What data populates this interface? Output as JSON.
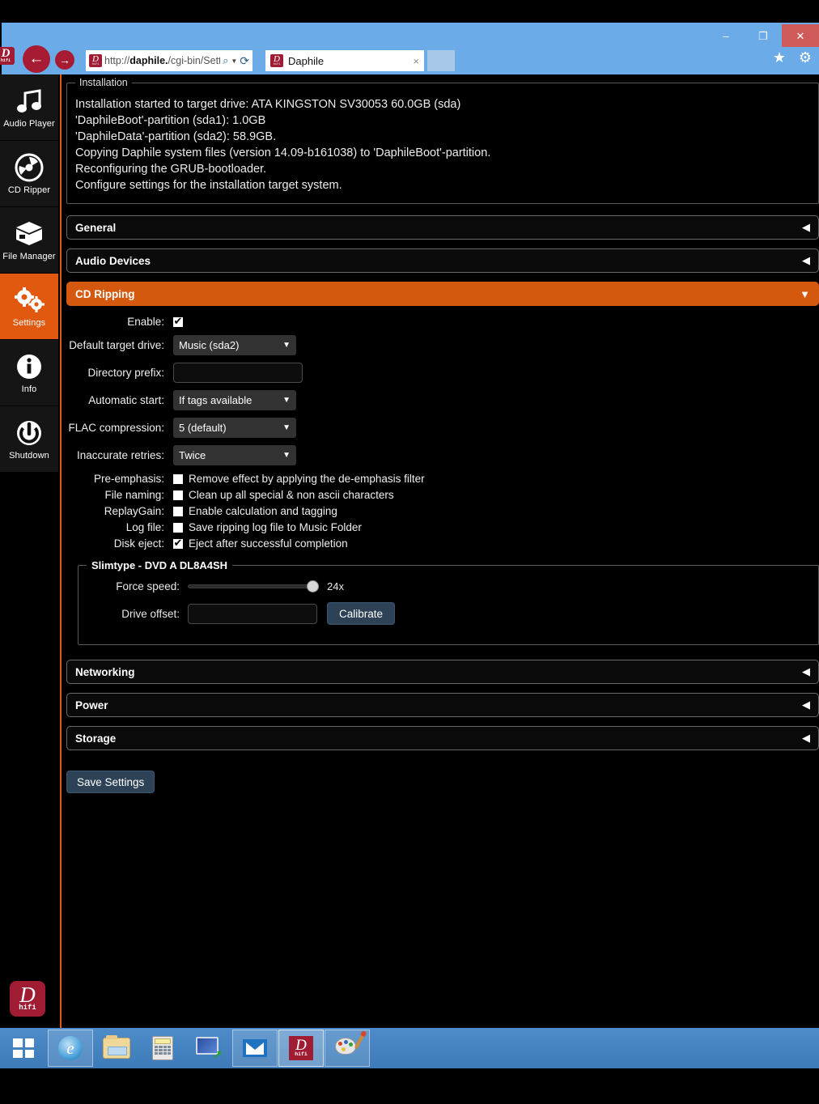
{
  "browser": {
    "url_prefix": "http://",
    "url_domain": "daphile.",
    "url_path": "/cgi-bin/Sett",
    "tab_title": "Daphile",
    "tab_close": "×",
    "back_icon": "←",
    "forward_icon": "→",
    "search_icon": "⌕",
    "caret_icon": "▼",
    "refresh_icon": "⟳",
    "favorites_icon": "★",
    "tools_icon": "⚙",
    "minimize_label": "–",
    "restore_label": "❐",
    "close_label": "✕",
    "logo_letter": "D",
    "logo_sub": "hifi"
  },
  "sidebar": {
    "items": [
      {
        "label": "Audio Player",
        "icon": "music-note-icon",
        "glyph": "♫",
        "active": false
      },
      {
        "label": "CD Ripper",
        "icon": "compact-disc-icon",
        "glyph": "◎",
        "active": false
      },
      {
        "label": "File Manager",
        "icon": "box-icon",
        "glyph": "⬛",
        "active": false
      },
      {
        "label": "Settings",
        "icon": "gears-icon",
        "glyph": "⚙",
        "active": true
      },
      {
        "label": "Info",
        "icon": "info-circle-icon",
        "glyph": "ℹ",
        "active": false
      },
      {
        "label": "Shutdown",
        "icon": "power-icon",
        "glyph": "⏻",
        "active": false
      }
    ],
    "logo_letter": "D",
    "logo_sub": "hifi"
  },
  "installation": {
    "legend": "Installation",
    "lines": [
      "Installation started to target drive: ATA KINGSTON SV30053 60.0GB (sda)",
      "'DaphileBoot'-partition (sda1): 1.0GB",
      "'DaphileData'-partition (sda2): 58.9GB.",
      "Copying Daphile system files (version 14.09-b161038) to 'DaphileBoot'-partition.",
      "Reconfiguring the GRUB-bootloader.",
      "Configure settings for the installation target system."
    ]
  },
  "sections": {
    "general": {
      "title": "General",
      "arrow": "◀"
    },
    "audio_devices": {
      "title": "Audio Devices",
      "arrow": "◀"
    },
    "cd_ripping": {
      "title": "CD Ripping",
      "arrow": "▼"
    },
    "networking": {
      "title": "Networking",
      "arrow": "◀"
    },
    "power": {
      "title": "Power",
      "arrow": "◀"
    },
    "storage": {
      "title": "Storage",
      "arrow": "◀"
    }
  },
  "cd_ripping": {
    "enable": {
      "label": "Enable:",
      "checked": true
    },
    "default_target_drive": {
      "label": "Default target drive:",
      "value": "Music (sda2)",
      "arrow": "▼"
    },
    "directory_prefix": {
      "label": "Directory prefix:",
      "value": "",
      "placeholder": ""
    },
    "automatic_start": {
      "label": "Automatic start:",
      "value": "If tags available",
      "arrow": "▼"
    },
    "flac_compression": {
      "label": "FLAC compression:",
      "value": "5 (default)",
      "arrow": "▼"
    },
    "inaccurate_retries": {
      "label": "Inaccurate retries:",
      "value": "Twice",
      "arrow": "▼"
    },
    "checkboxes": [
      {
        "label": "Pre-emphasis:",
        "text": "Remove effect by applying the de-emphasis filter",
        "checked": false
      },
      {
        "label": "File naming:",
        "text": "Clean up all special & non ascii characters",
        "checked": false
      },
      {
        "label": "ReplayGain:",
        "text": "Enable calculation and tagging",
        "checked": false
      },
      {
        "label": "Log file:",
        "text": "Save ripping log file to Music Folder",
        "checked": false
      },
      {
        "label": "Disk eject:",
        "text": "Eject after successful completion",
        "checked": true
      }
    ],
    "drive": {
      "legend": "Slimtype - DVD A DL8A4SH",
      "force_speed": {
        "label": "Force speed:",
        "value": "24x",
        "percent": 96
      },
      "drive_offset": {
        "label": "Drive offset:",
        "value": ""
      },
      "calibrate_label": "Calibrate"
    }
  },
  "footer": {
    "save_label": "Save Settings"
  },
  "taskbar": {
    "items": [
      {
        "name": "start-button",
        "icon": "windows-logo-icon",
        "state": "start"
      },
      {
        "name": "internet-explorer",
        "icon": "internet-explorer-icon",
        "state": "pinned"
      },
      {
        "name": "file-explorer",
        "icon": "folder-icon",
        "state": "plain"
      },
      {
        "name": "calculator",
        "icon": "calculator-icon",
        "state": "plain"
      },
      {
        "name": "remote-desktop",
        "icon": "remote-desktop-icon",
        "state": "plain"
      },
      {
        "name": "mail",
        "icon": "mail-icon",
        "state": "pinned"
      },
      {
        "name": "daphile",
        "icon": "daphile-logo-icon",
        "state": "running"
      },
      {
        "name": "paint",
        "icon": "paint-palette-icon",
        "state": "pinned"
      }
    ]
  },
  "colors": {
    "accent_orange": "#d4590f",
    "sidebar_active": "#e0590f",
    "brand_red": "#a01c33",
    "button_blue": "#2e4257",
    "chrome_blue": "#6babe8",
    "close_red": "#cf5a5a"
  }
}
